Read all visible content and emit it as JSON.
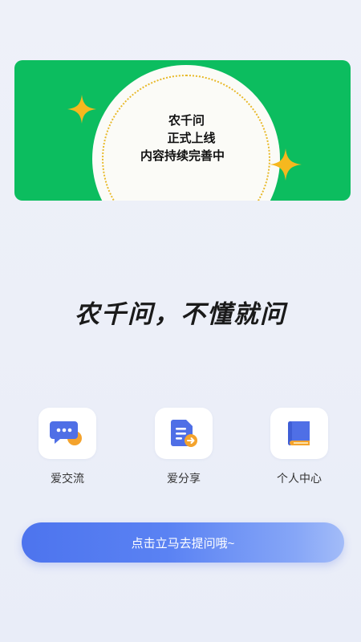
{
  "banner": {
    "line1": "农千问",
    "line2": "正式上线",
    "line3": "内容持续完善中"
  },
  "slogan": "农千问，不懂就问",
  "features": [
    {
      "label": "爱交流",
      "icon": "chat-bubbles-icon"
    },
    {
      "label": "爱分享",
      "icon": "share-document-icon"
    },
    {
      "label": "个人中心",
      "icon": "book-icon"
    }
  ],
  "cta": {
    "label": "点击立马去提问哦~"
  },
  "colors": {
    "banner_green": "#0cbd5f",
    "star_yellow": "#f6b81e",
    "accent_blue": "#4d74ee",
    "icon_orange": "#f4a32c"
  }
}
